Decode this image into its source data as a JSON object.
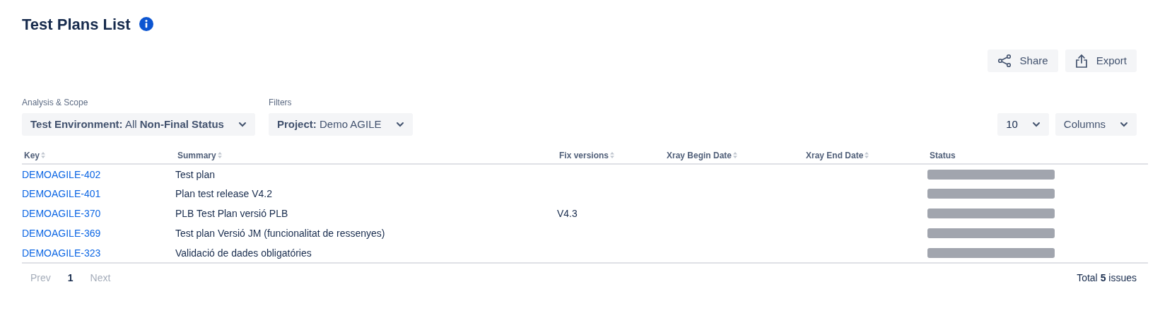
{
  "page": {
    "title": "Test Plans List"
  },
  "actions": [
    {
      "kind": "share",
      "label": "Share"
    },
    {
      "kind": "export",
      "label": "Export"
    }
  ],
  "selectors": [
    {
      "label": "Analysis & Scope",
      "value": "**Test Environment:** All **Non-Final Status**"
    },
    {
      "label": "Filters",
      "value": "**Project:** Demo AGILE"
    }
  ],
  "page_size": {
    "value": "10"
  },
  "columns_button": {
    "label": "Columns"
  },
  "table": {
    "columns": [
      {
        "label": "Key",
        "sortable": true
      },
      {
        "label": "Summary",
        "sortable": true
      },
      {
        "label": "Fix versions",
        "sortable": true
      },
      {
        "label": "Xray Begin Date",
        "sortable": true
      },
      {
        "label": "Xray End Date",
        "sortable": true
      },
      {
        "label": "Status",
        "sortable": false
      }
    ],
    "rows": [
      {
        "key": "DEMOAGILE-402",
        "summary": "Test plan",
        "status": {
          "kind": "placeholder"
        }
      },
      {
        "key": "DEMOAGILE-401",
        "summary": "Plan test release V4.2",
        "status": {
          "kind": "placeholder"
        }
      },
      {
        "key": "DEMOAGILE-370",
        "summary": "PLB Test Plan versió PLB",
        "fix_versions": "V4.3",
        "status": {
          "kind": "placeholder"
        }
      },
      {
        "key": "DEMOAGILE-369",
        "summary": "Test plan Versió JM (funcionalitat de ressenyes)",
        "status": {
          "kind": "placeholder"
        }
      },
      {
        "key": "DEMOAGILE-323",
        "summary": "Validació de dades obligatóries",
        "status": {
          "kind": "placeholder"
        }
      }
    ]
  },
  "pagination": {
    "items": [
      {
        "label": "Prev",
        "selected": false,
        "disabled": true
      },
      {
        "label": "1",
        "selected": true,
        "disabled": false
      },
      {
        "label": "Next",
        "selected": false,
        "disabled": true
      }
    ],
    "total": "Total **5** issues"
  }
}
